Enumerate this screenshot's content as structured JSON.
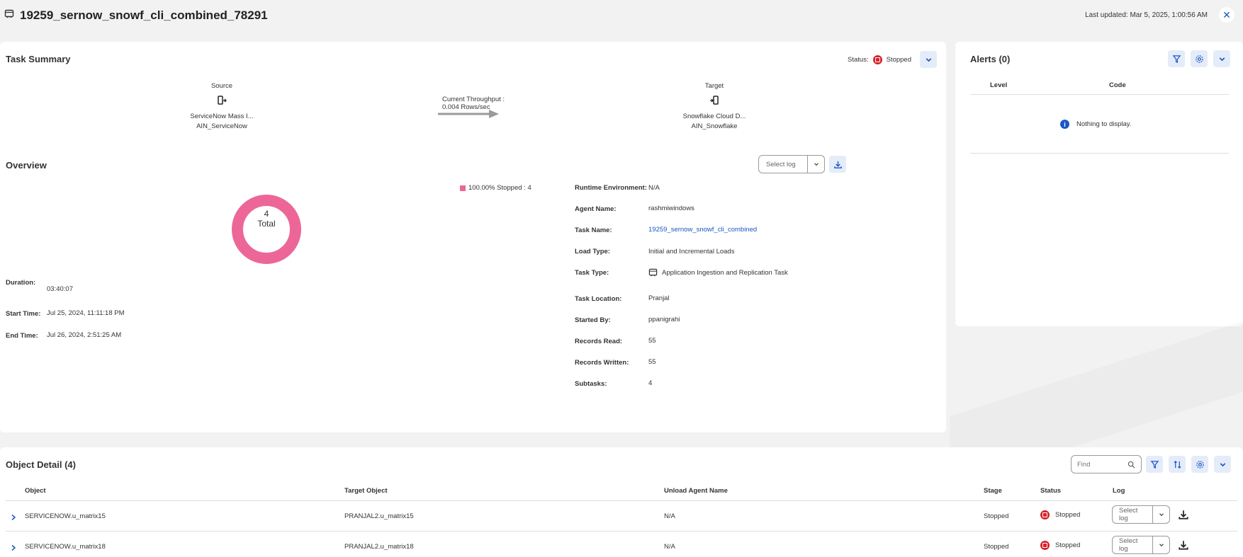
{
  "header": {
    "title": "19259_sernow_snowf_cli_combined_78291",
    "last_updated": "Last updated: Mar 5, 2025, 1:00:56 AM"
  },
  "task_summary": {
    "title": "Task Summary",
    "status_label": "Status:",
    "status_value": "Stopped",
    "source_heading": "Source",
    "source_name": "ServiceNow Mass I...",
    "source_conn": "AIN_ServiceNow",
    "throughput_label": "Current Throughput :",
    "throughput_value": "0.004 Rows/sec",
    "target_heading": "Target",
    "target_name": "Snowflake Cloud D...",
    "target_conn": "AIN_Snowflake"
  },
  "overview": {
    "title": "Overview",
    "select_log_placeholder": "Select log",
    "donut_count": "4",
    "donut_label": "Total",
    "legend": "100.00% Stopped : 4",
    "stopped_pct": 100,
    "donut_color": "#ec6797",
    "duration_label": "Duration:",
    "duration_value": "03:40:07",
    "start_label": "Start Time:",
    "start_value": "Jul 25, 2024, 11:11:18 PM",
    "end_label": "End Time:",
    "end_value": "Jul 26, 2024, 2:51:25 AM",
    "details": [
      {
        "label": "Runtime Environment:",
        "value": "N/A"
      },
      {
        "label": "Agent Name:",
        "value": "rashmiwindows"
      },
      {
        "label": "Task Name:",
        "value": "19259_sernow_snowf_cli_combined"
      },
      {
        "label": "Load Type:",
        "value": "Initial and Incremental Loads"
      },
      {
        "label": "Task Type:",
        "value": "Application Ingestion and Replication Task"
      },
      {
        "label": "Task Location:",
        "value": "Pranjal"
      },
      {
        "label": "Started By:",
        "value": "ppanigrahi"
      },
      {
        "label": "Records Read:",
        "value": "55"
      },
      {
        "label": "Records Written:",
        "value": "55"
      },
      {
        "label": "Subtasks:",
        "value": "4"
      }
    ]
  },
  "alerts": {
    "title": "Alerts (0)",
    "col_level": "Level",
    "col_code": "Code",
    "empty": "Nothing to display."
  },
  "object_detail": {
    "title": "Object Detail (4)",
    "find_placeholder": "Find",
    "columns": [
      "Object",
      "Target Object",
      "Unload Agent Name",
      "Stage",
      "Status",
      "Log"
    ],
    "rows": [
      {
        "object": "SERVICENOW.u_matrix15",
        "target": "PRANJAL2.u_matrix15",
        "agent": "N/A",
        "stage": "Stopped",
        "status": "Stopped",
        "log": "Select log"
      },
      {
        "object": "SERVICENOW.u_matrix18",
        "target": "PRANJAL2.u_matrix18",
        "agent": "N/A",
        "stage": "Stopped",
        "status": "Stopped",
        "log": "Select log"
      }
    ]
  },
  "colors": {
    "accent": "#1a56c4",
    "stopped": "#d6232b",
    "donut": "#ec6797"
  }
}
